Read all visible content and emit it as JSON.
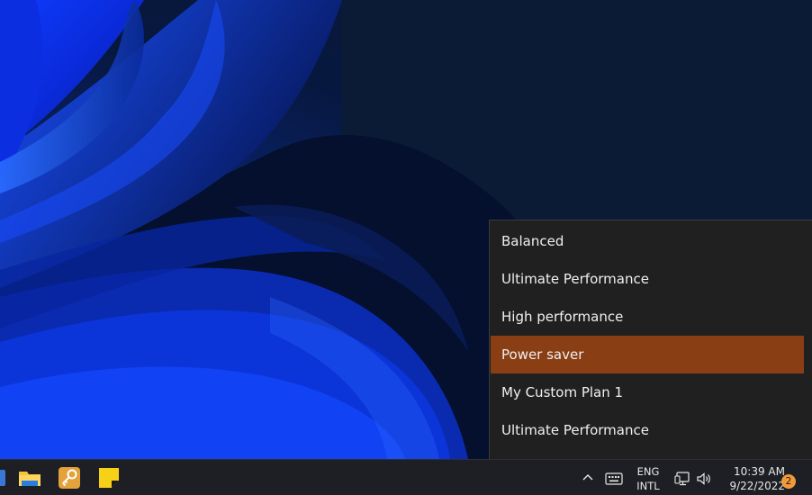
{
  "desktop": {
    "wallpaper": "windows-11-bloom-wallpaper"
  },
  "power_menu": {
    "items": [
      {
        "label": "Balanced",
        "selected": false
      },
      {
        "label": "Ultimate Performance",
        "selected": false
      },
      {
        "label": "High performance",
        "selected": false
      },
      {
        "label": "Power saver",
        "selected": true
      },
      {
        "label": "My Custom Plan 1",
        "selected": false
      },
      {
        "label": "Ultimate Performance",
        "selected": false
      }
    ],
    "highlight_color": "#8a3e14"
  },
  "taskbar": {
    "apps": [
      {
        "icon": "app-icon-partial"
      },
      {
        "icon": "file-explorer-icon"
      },
      {
        "icon": "key-icon"
      },
      {
        "icon": "sticky-notes-icon"
      }
    ],
    "tray": {
      "chevron_icon": "chevron-up-icon",
      "keyboard_icon": "keyboard-icon",
      "language_line1": "ENG",
      "language_line2": "INTL",
      "network_icon": "network-icon",
      "volume_icon": "speaker-icon",
      "time": "10:39 AM",
      "date": "9/22/2022",
      "notification_count": "2"
    }
  }
}
